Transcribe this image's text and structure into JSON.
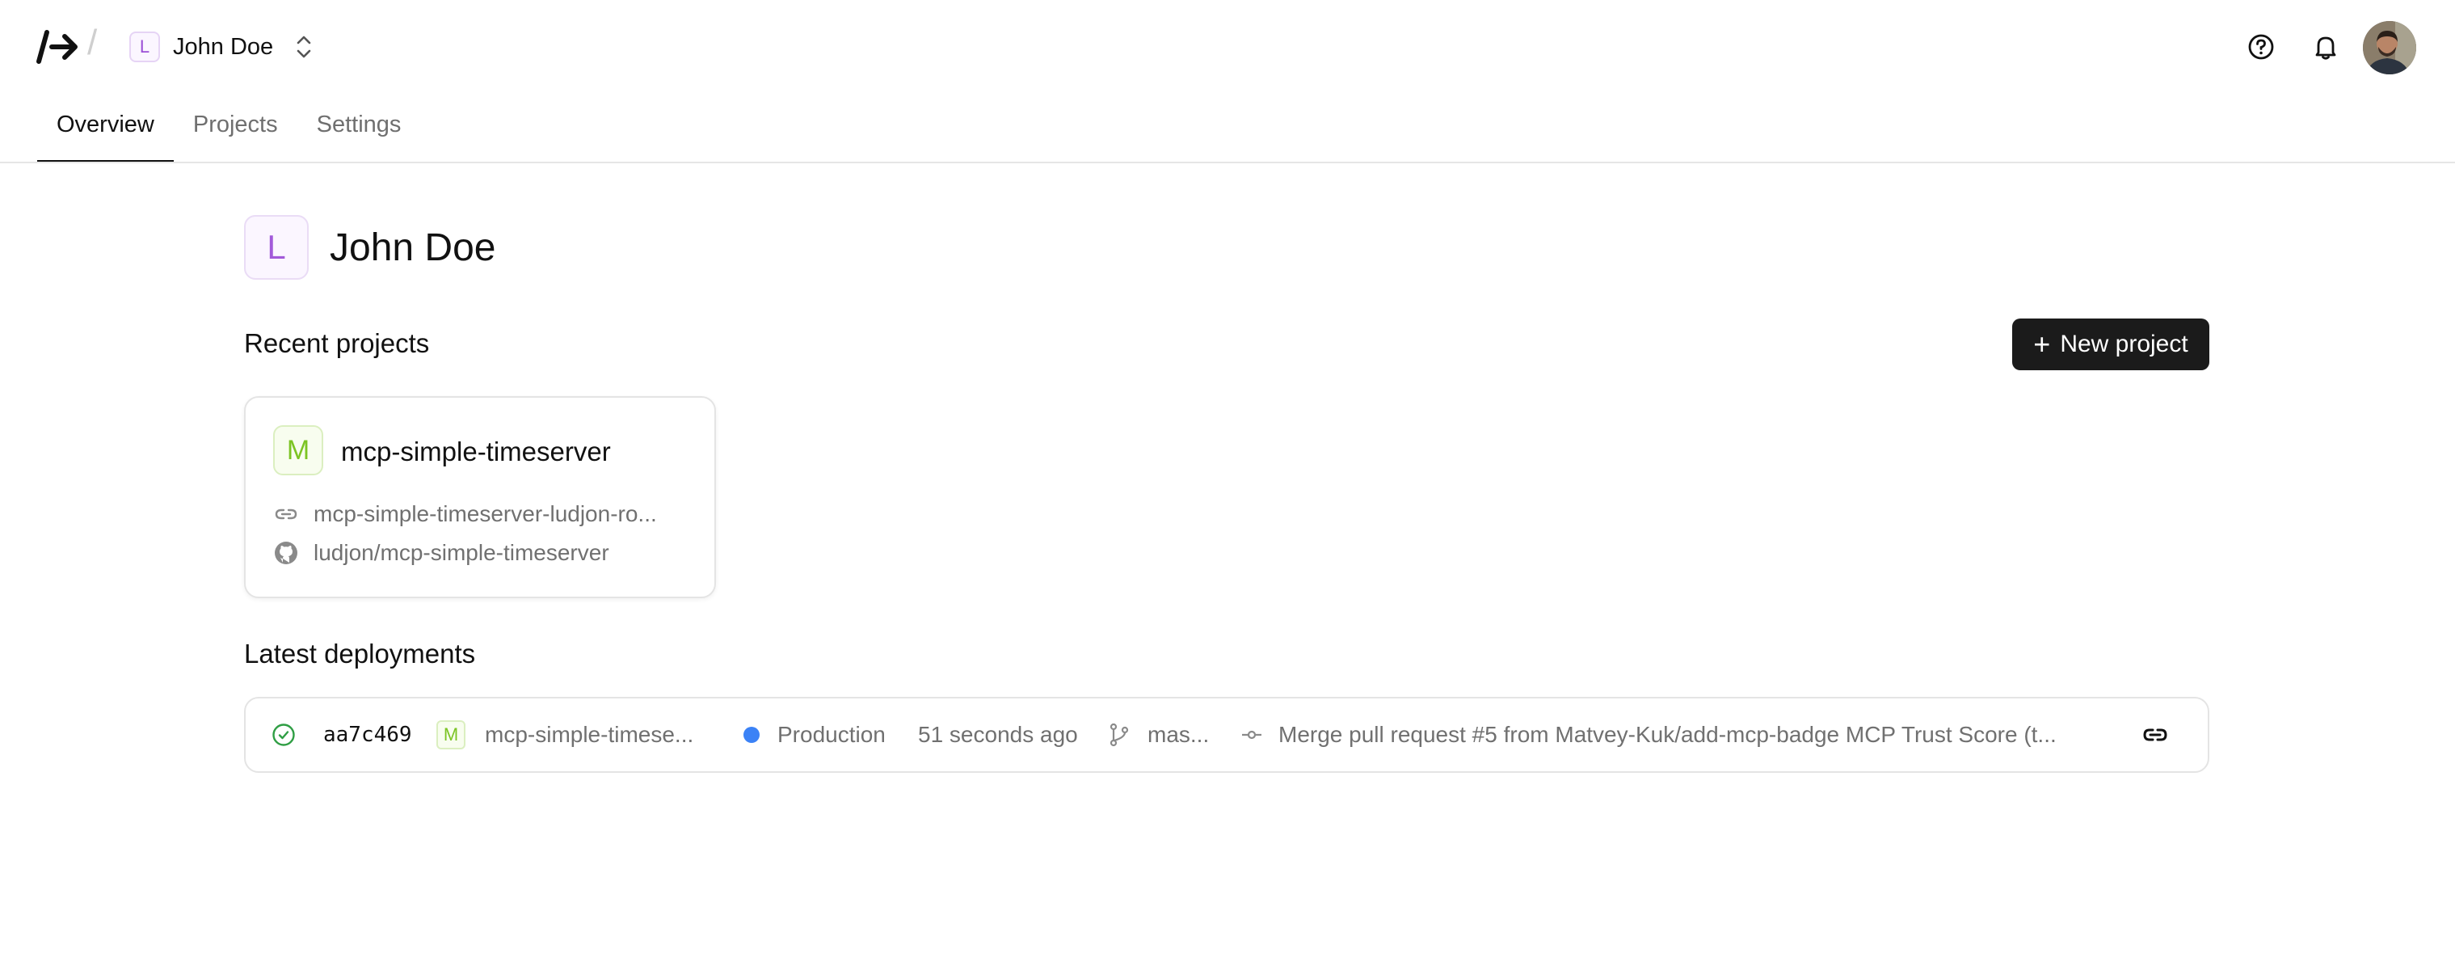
{
  "header": {
    "team_initial": "L",
    "team_name": "John Doe",
    "icons": [
      "logo-icon",
      "chevron-updown-icon",
      "help-icon",
      "bell-icon",
      "user-avatar"
    ]
  },
  "tabs": [
    {
      "label": "Overview",
      "active": true
    },
    {
      "label": "Projects",
      "active": false
    },
    {
      "label": "Settings",
      "active": false
    }
  ],
  "team": {
    "initial": "L",
    "title": "John Doe"
  },
  "recent_projects": {
    "title": "Recent projects",
    "new_button_label": "New project",
    "items": [
      {
        "initial": "M",
        "name": "mcp-simple-timeserver",
        "url": "mcp-simple-timeserver-ludjon-ro...",
        "repo": "ludjon/mcp-simple-timeserver"
      }
    ]
  },
  "latest_deployments": {
    "title": "Latest deployments",
    "items": [
      {
        "status": "success",
        "hash": "aa7c469",
        "project_initial": "M",
        "project": "mcp-simple-timese...",
        "environment": "Production",
        "time": "51 seconds ago",
        "branch": "mas...",
        "commit_message": "Merge pull request #5 from Matvey-Kuk/add-mcp-badge MCP Trust Score (t..."
      }
    ]
  },
  "colors": {
    "primary_button": "#1b1b1b",
    "team_accent": "#a25ad9",
    "project_accent": "#7cc423",
    "production_dot": "#3b82f6",
    "success": "#2f9e44"
  }
}
